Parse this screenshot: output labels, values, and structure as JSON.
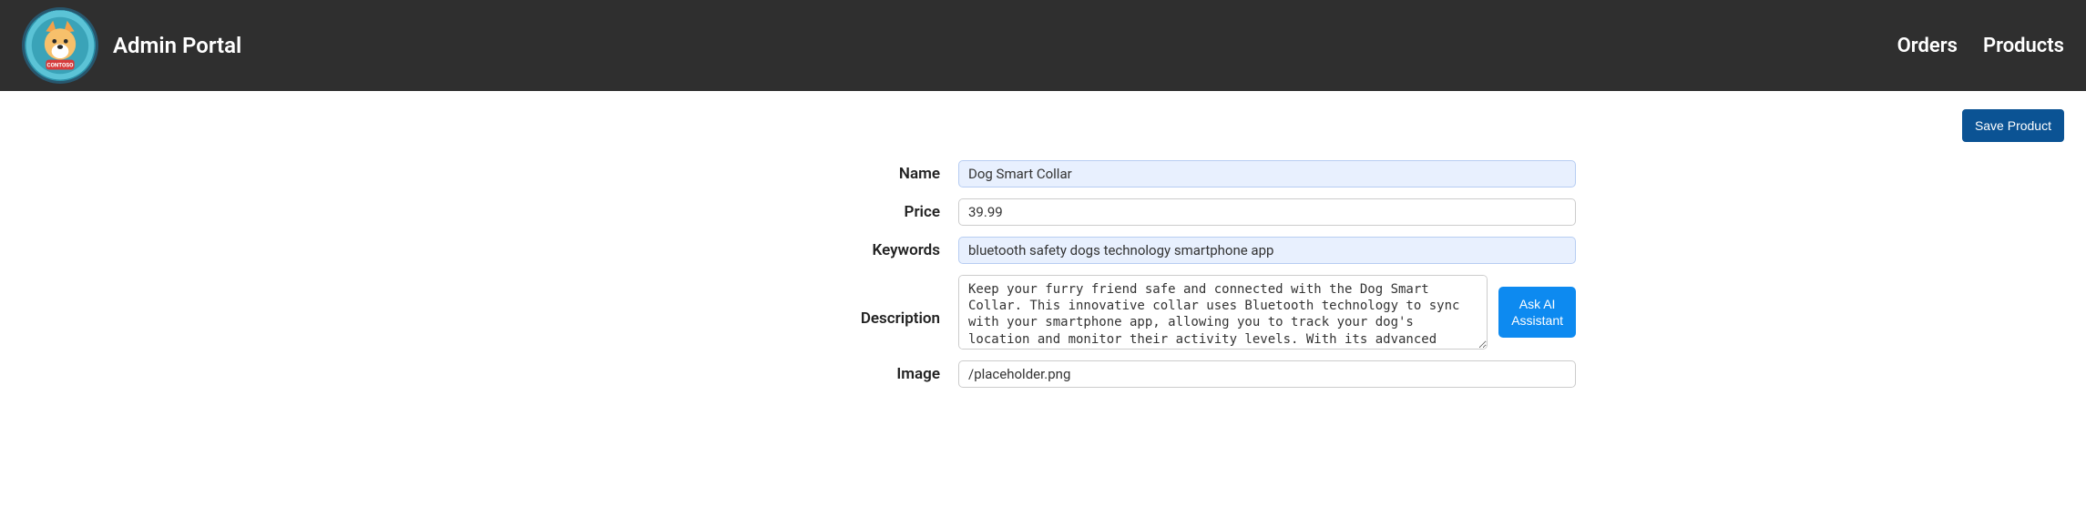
{
  "header": {
    "title": "Admin Portal",
    "nav": {
      "orders": "Orders",
      "products": "Products"
    }
  },
  "toolbar": {
    "save_label": "Save Product"
  },
  "form": {
    "name_label": "Name",
    "name_value": "Dog Smart Collar",
    "price_label": "Price",
    "price_value": "39.99",
    "keywords_label": "Keywords",
    "keywords_value": "bluetooth safety dogs technology smartphone app",
    "description_label": "Description",
    "description_value": "Keep your furry friend safe and connected with the Dog Smart Collar. This innovative collar uses Bluetooth technology to sync with your smartphone app, allowing you to track your dog's location and monitor their activity levels. With its advanced safety features, you can rest easy knowing your dog is always within reach.",
    "ask_ai_label": "Ask AI Assistant",
    "image_label": "Image",
    "image_value": "/placeholder.png"
  }
}
